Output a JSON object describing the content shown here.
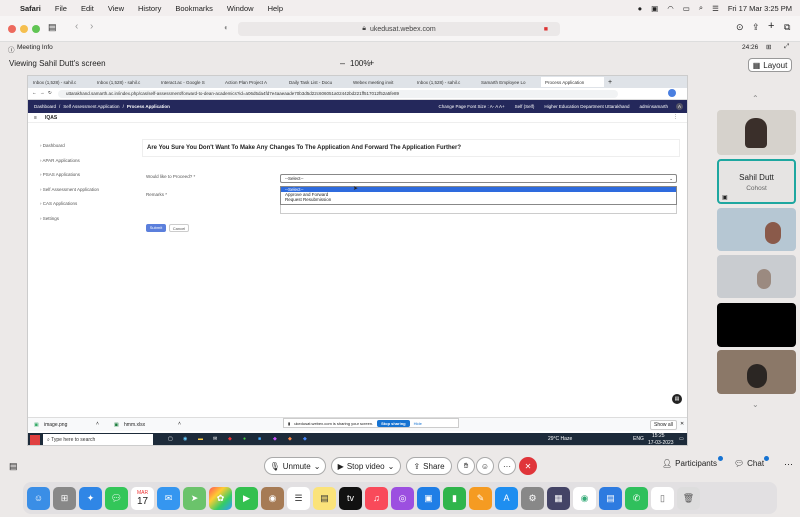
{
  "mac_menubar": {
    "apple": "",
    "items": [
      "Safari",
      "File",
      "Edit",
      "View",
      "History",
      "Bookmarks",
      "Window",
      "Help"
    ],
    "datetime": "Fri 17 Mar  3:25 PM"
  },
  "safari": {
    "url": "ukedusat.webex.com"
  },
  "webex": {
    "meeting_info": "Meeting Info",
    "timer": "24:26",
    "viewing": "Viewing Sahil Dutt's screen",
    "zoom_minus": "–",
    "zoom": "100%",
    "zoom_plus": "+",
    "layout": "Layout"
  },
  "shared": {
    "tabs": [
      {
        "label": "Inbox (1,528) - sahil.c"
      },
      {
        "label": "Inbox (1,528) - sahil.c"
      },
      {
        "label": "Interact.ac - Google S"
      },
      {
        "label": "Action Plan Project A"
      },
      {
        "label": "Daily Task List - Docu"
      },
      {
        "label": "Webex meeting invit"
      },
      {
        "label": "Inbox (1,528) - sahil.c"
      },
      {
        "label": "Samarth Employee Lo"
      },
      {
        "label": "Process Application",
        "active": true
      }
    ],
    "new_tab": "+",
    "address": "uttarakhand.samarth.ac.in/index.php/cas/self-assessment/forward-to-dean-academics?id=a06d5da4fd7e4aaeaade70b3d5d22c606051a02442bd221ff517012f52a5fe89",
    "app_nav": {
      "breadcrumb": [
        "Dashboard",
        "Self Assessment Application",
        "Process Application"
      ],
      "font_size": "Change Page Font Size :  A-  A  A+",
      "user": "Self (Self)",
      "department": "Higher Education Department Uttarakhand",
      "admin": "adminsamarth",
      "avatar": "A"
    },
    "sub_label": "IQAS",
    "sidebar": [
      "Dashboard",
      "APAR Applications",
      "PSAS Applications",
      "Self Assessment Application",
      "CAS Applications",
      "Settings"
    ],
    "question": "Are You Sure You Don't Want To Make Any Changes To The Application And Forward The Application Further?",
    "proceed_label": "Would like to Proceed? *",
    "remarks_label": "Remarks *",
    "select_value": "--Select--",
    "options": [
      "--Select--",
      "Approve and Forward",
      "Request Resubmission"
    ],
    "submit": "Submit",
    "cancel": "Cancel",
    "downloads": [
      {
        "name": "image.png"
      },
      {
        "name": "hmm.xlsx"
      }
    ],
    "show_all": "Show all",
    "share_banner": {
      "text": "ukedusat.webex.com is sharing your screen.",
      "stop": "Stop sharing",
      "hide": "Hide"
    },
    "taskbar": {
      "search": "Type here to search",
      "weather": "29°C  Haze",
      "lang": "ENG",
      "time": "15:25",
      "date": "17-03-2023"
    }
  },
  "participants_panel": {
    "name": "Sahil Dutt",
    "role": "Cohost"
  },
  "controls": {
    "unmute": "Unmute",
    "stop_video": "Stop video",
    "share": "Share",
    "participants": "Participants",
    "chat": "Chat",
    "more": "···"
  },
  "dock": {
    "calendar_month": "MAR",
    "calendar_day": "17"
  }
}
